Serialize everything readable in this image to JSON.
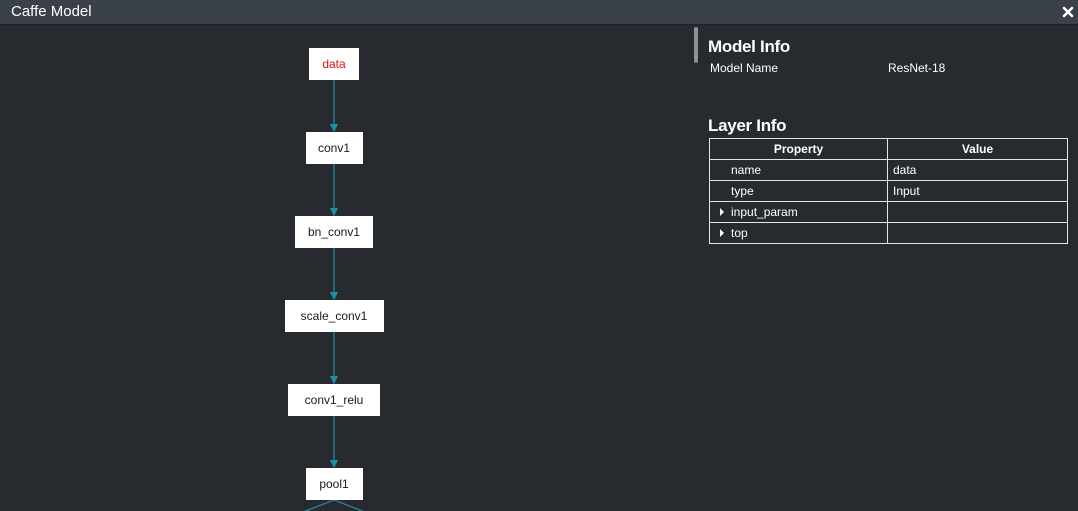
{
  "window": {
    "title": "Caffe Model",
    "close_icon": "close-icon"
  },
  "colors": {
    "background": "#272b30",
    "titlebar": "#3a4048",
    "edge": "#1f8fa3",
    "node_fill": "#ffffff",
    "selected_node_text": "#e01010",
    "text": "#ffffff"
  },
  "graph": {
    "nodes": [
      {
        "label": "data",
        "selected": true
      },
      {
        "label": "conv1",
        "selected": false
      },
      {
        "label": "bn_conv1",
        "selected": false
      },
      {
        "label": "scale_conv1",
        "selected": false
      },
      {
        "label": "conv1_relu",
        "selected": false
      },
      {
        "label": "pool1",
        "selected": false
      }
    ]
  },
  "model_info": {
    "heading": "Model Info",
    "name_label": "Model Name",
    "name_value": "ResNet-18"
  },
  "layer_info": {
    "heading": "Layer Info",
    "columns": [
      "Property",
      "Value"
    ],
    "rows": [
      {
        "property": "name",
        "value": "data",
        "expandable": false
      },
      {
        "property": "type",
        "value": "Input",
        "expandable": false
      },
      {
        "property": "input_param",
        "value": "",
        "expandable": true
      },
      {
        "property": "top",
        "value": "",
        "expandable": true
      }
    ]
  }
}
